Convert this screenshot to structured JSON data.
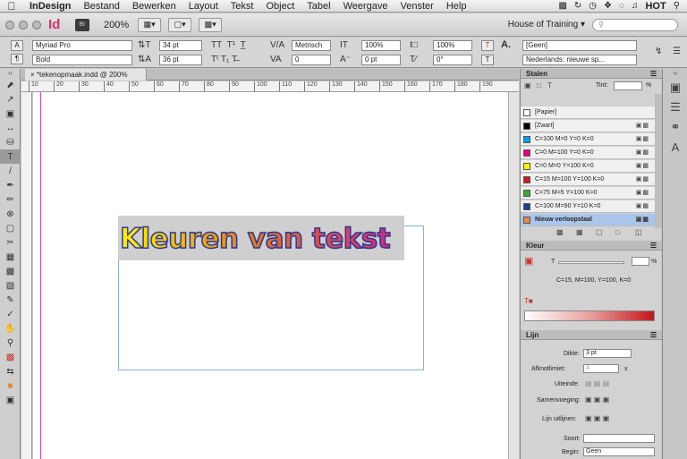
{
  "menubar": {
    "app": "InDesign",
    "items": [
      "Bestand",
      "Bewerken",
      "Layout",
      "Tekst",
      "Object",
      "Tabel",
      "Weergave",
      "Venster",
      "Help"
    ],
    "tray_label": "HOT"
  },
  "appbar": {
    "logo": "Id",
    "bridge": "Br",
    "zoom": "200%",
    "workspace": "House of Training"
  },
  "control": {
    "font": "Myriad Pro",
    "style": "Bold",
    "size": "34 pt",
    "leading": "36 pt",
    "kerning": "Metrisch",
    "tracking": "0",
    "hscale": "100%",
    "vscale": "100%",
    "baseline": "0 pt",
    "skew": "0°",
    "charstyle": "[Geen]",
    "language": "Nederlands: nieuwe sp..."
  },
  "document": {
    "tab": "*tekenopmaak.indd @ 200%",
    "headline": "Kleuren van tekst",
    "ruler": [
      "10",
      "20",
      "30",
      "40",
      "50",
      "60",
      "70",
      "80",
      "90",
      "100",
      "110",
      "120",
      "130",
      "140",
      "150",
      "160",
      "170",
      "180",
      "190"
    ]
  },
  "swatches": {
    "title": "Stalen",
    "tint_label": "Tint:",
    "tint_unit": "%",
    "items": [
      {
        "name": "[Papier]",
        "color": "#ffffff"
      },
      {
        "name": "[Zwart]",
        "color": "#000000"
      },
      {
        "name": "C=100 M=0 Y=0 K=0",
        "color": "#00a0e0"
      },
      {
        "name": "C=0 M=100 Y=0 K=0",
        "color": "#e4007c"
      },
      {
        "name": "C=0 M=0 Y=100 K=0",
        "color": "#fff200"
      },
      {
        "name": "C=15 M=100 Y=100 K=0",
        "color": "#cc1b22"
      },
      {
        "name": "C=75 M=5 Y=100 K=0",
        "color": "#3aa935"
      },
      {
        "name": "C=100 M=90 Y=10 K=0",
        "color": "#1f3c8f"
      },
      {
        "name": "Nieuw verloopstaal",
        "color": "#e8884a"
      }
    ]
  },
  "kleur": {
    "title": "Kleur",
    "tint_label": "T",
    "unit": "%",
    "value": "C=15, M=100, Y=100, K=0"
  },
  "lijn": {
    "title": "Lijn",
    "dikte_label": "Dikte:",
    "dikte": "3 pt",
    "afknot_label": "Afknotlimiet:",
    "afknot": "4",
    "afknot_unit": "x",
    "uiteinde_label": "Uiteinde:",
    "samenvoeging_label": "Samenvoeging:",
    "uitlijnen_label": "Lijn uitlijnen:",
    "soort_label": "Soort:",
    "begin_label": "Begin:",
    "begin": "Geen"
  }
}
